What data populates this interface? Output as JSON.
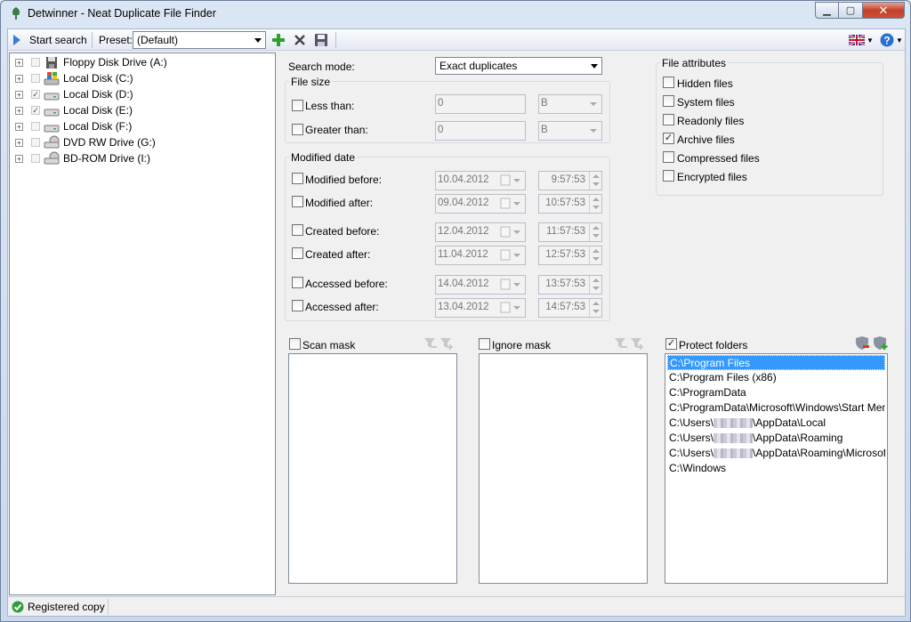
{
  "window": {
    "title": "Detwinner - Neat Duplicate File Finder"
  },
  "toolbar": {
    "start_search": "Start search",
    "preset_label": "Preset:",
    "preset_value": "(Default)"
  },
  "drives": [
    {
      "label": "Floppy Disk Drive (A:)",
      "checked": false,
      "icon": "floppy-drive-icon"
    },
    {
      "label": "Local Disk (C:)",
      "checked": false,
      "icon": "windows-drive-icon"
    },
    {
      "label": "Local Disk (D:)",
      "checked": true,
      "icon": "hard-drive-icon"
    },
    {
      "label": "Local Disk (E:)",
      "checked": true,
      "icon": "hard-drive-icon"
    },
    {
      "label": "Local Disk (F:)",
      "checked": false,
      "icon": "hard-drive-icon"
    },
    {
      "label": "DVD RW Drive (G:)",
      "checked": false,
      "icon": "dvd-drive-icon"
    },
    {
      "label": "BD-ROM Drive (I:)",
      "checked": false,
      "icon": "bd-drive-icon"
    }
  ],
  "search_mode": {
    "label": "Search mode:",
    "value": "Exact duplicates"
  },
  "file_size": {
    "title": "File size",
    "less_than": {
      "label": "Less than:",
      "value": "0",
      "unit": "B"
    },
    "greater_than": {
      "label": "Greater than:",
      "value": "0",
      "unit": "B"
    }
  },
  "modified_date": {
    "title": "Modified date",
    "rows": [
      {
        "label": "Modified before:",
        "date": "10.04.2012",
        "time": "9:57:53"
      },
      {
        "label": "Modified after:",
        "date": "09.04.2012",
        "time": "10:57:53"
      },
      {
        "label": "Created before:",
        "date": "12.04.2012",
        "time": "11:57:53"
      },
      {
        "label": "Created after:",
        "date": "11.04.2012",
        "time": "12:57:53"
      },
      {
        "label": "Accessed before:",
        "date": "14.04.2012",
        "time": "13:57:53"
      },
      {
        "label": "Accessed after:",
        "date": "13.04.2012",
        "time": "14:57:53"
      }
    ]
  },
  "file_attributes": {
    "title": "File attributes",
    "items": [
      {
        "label": "Hidden files",
        "checked": false
      },
      {
        "label": "System files",
        "checked": false
      },
      {
        "label": "Readonly files",
        "checked": false
      },
      {
        "label": "Archive files",
        "checked": true
      },
      {
        "label": "Compressed files",
        "checked": false
      },
      {
        "label": "Encrypted files",
        "checked": false
      }
    ]
  },
  "scan_mask": {
    "label": "Scan mask",
    "checked": false
  },
  "ignore_mask": {
    "label": "Ignore mask",
    "checked": false
  },
  "protect_folders": {
    "label": "Protect folders",
    "checked": true,
    "items": [
      {
        "pre": "C:\\Program Files",
        "post": "",
        "blur": false,
        "selected": true
      },
      {
        "pre": "C:\\Program Files (x86)",
        "post": "",
        "blur": false,
        "selected": false
      },
      {
        "pre": "C:\\ProgramData",
        "post": "",
        "blur": false,
        "selected": false
      },
      {
        "pre": "C:\\ProgramData\\Microsoft\\Windows\\Start Menu",
        "post": "",
        "blur": false,
        "selected": false
      },
      {
        "pre": "C:\\Users\\",
        "post": "\\AppData\\Local",
        "blur": true,
        "selected": false
      },
      {
        "pre": "C:\\Users\\",
        "post": "\\AppData\\Roaming",
        "blur": true,
        "selected": false
      },
      {
        "pre": "C:\\Users\\",
        "post": "\\AppData\\Roaming\\Microsoft\\W",
        "blur": true,
        "selected": false
      },
      {
        "pre": "C:\\Windows",
        "post": "",
        "blur": false,
        "selected": false
      }
    ]
  },
  "status": {
    "text": "Registered copy"
  }
}
